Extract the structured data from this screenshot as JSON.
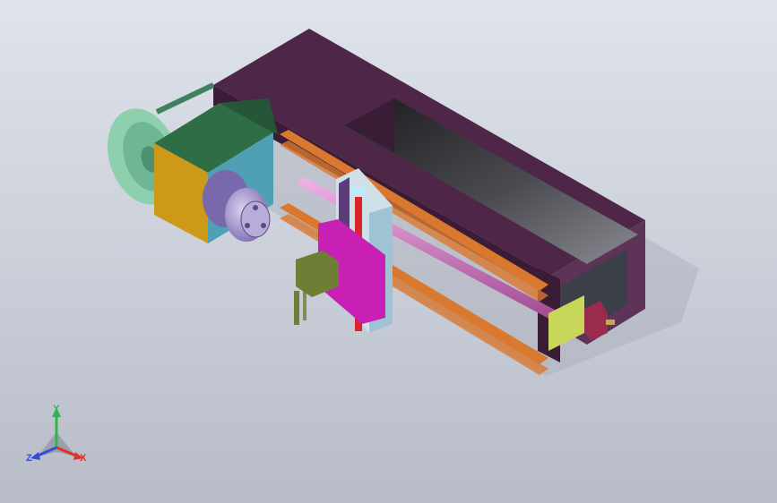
{
  "colors": {
    "frame": "#4e2748",
    "frame_dark": "#3a1c36",
    "frame_light": "#5e3358",
    "rail": "#d9782f",
    "headstock_top": "#2f6e45",
    "headstock_side": "#cc9a18",
    "headstock_front": "#4fa0b4",
    "chuck": "#9a86c8",
    "pulley": "#8ecfae",
    "carriage": "#c81fb4",
    "motor": "#6e7e34",
    "stepper": "#9a2b4c",
    "shaft": "#d46ec0",
    "spindle": "#d8262a",
    "bracket": "#c8d65a",
    "axis_x": "#e0312c",
    "axis_y": "#2fb64b",
    "axis_z": "#2f4fd8"
  },
  "icons": {
    "triad": "axis-triad-icon"
  },
  "triad": {
    "x_label": "X",
    "y_label": "Y",
    "z_label": "Z"
  }
}
